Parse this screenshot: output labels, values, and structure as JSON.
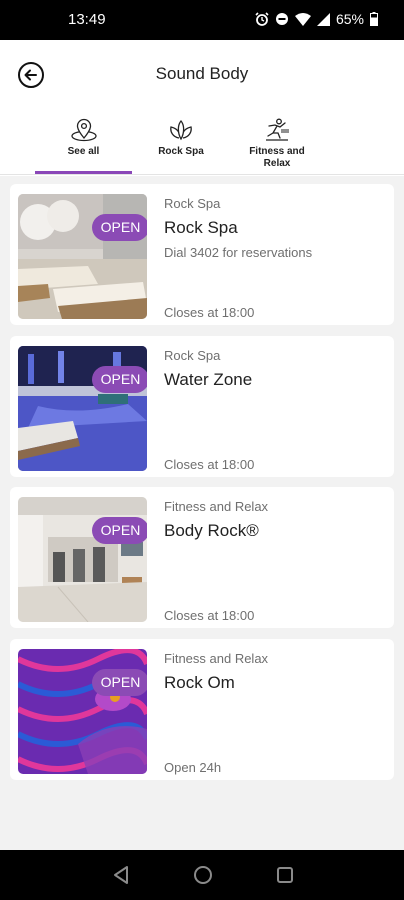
{
  "status_bar": {
    "time": "13:49",
    "battery": "65%",
    "icons": [
      "alarm-icon",
      "dnd-icon",
      "wifi-icon",
      "signal-icon",
      "battery-icon"
    ]
  },
  "header": {
    "title": "Sound Body",
    "back_icon": "back-arrow-icon"
  },
  "tabs": [
    {
      "label": "See all",
      "icon": "location-pin-icon",
      "active": true
    },
    {
      "label": "Rock Spa",
      "icon": "lotus-icon",
      "active": false
    },
    {
      "label": "Fitness and Relax",
      "icon": "fitness-icon",
      "active": false
    }
  ],
  "venues": [
    {
      "badge": "OPEN",
      "category": "Rock Spa",
      "name": "Rock Spa",
      "description": "Dial 3402 for reservations",
      "hours": "Closes at 18:00",
      "image": "spa-lounge-photo"
    },
    {
      "badge": "OPEN",
      "category": "Rock Spa",
      "name": "Water Zone",
      "description": "",
      "hours": "Closes at 18:00",
      "image": "indoor-pool-photo"
    },
    {
      "badge": "OPEN",
      "category": "Fitness and Relax",
      "name": "Body Rock®",
      "description": "",
      "hours": "Closes at 18:00",
      "image": "gym-photo"
    },
    {
      "badge": "OPEN",
      "category": "Fitness and Relax",
      "name": "Rock Om",
      "description": "",
      "hours": "Open 24h",
      "image": "yoga-mat-photo"
    }
  ],
  "colors": {
    "accent": "#8a47b8",
    "badge": "#8b4bb5",
    "background": "#f2f2f2",
    "text_primary": "#222222",
    "text_secondary": "#6f6f6f"
  }
}
